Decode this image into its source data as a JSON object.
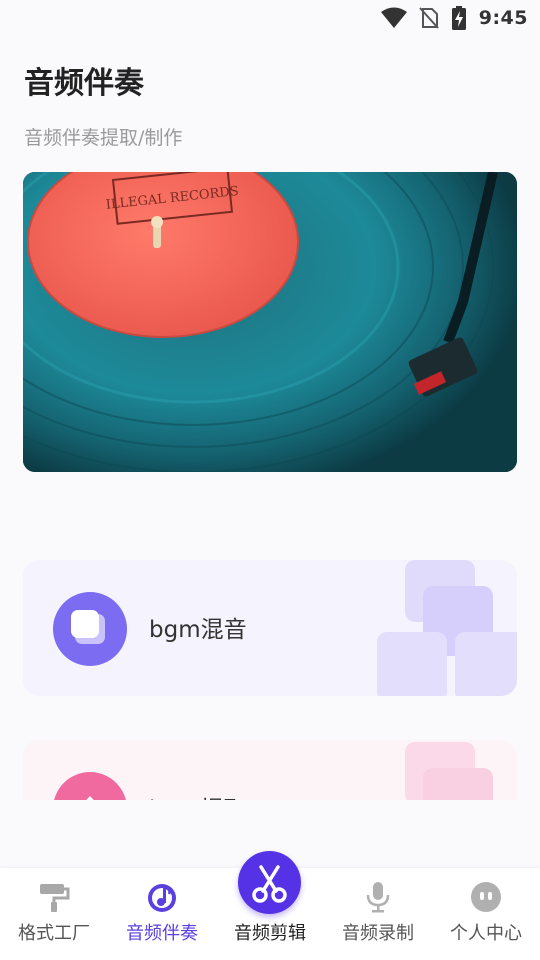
{
  "status_bar": {
    "time": "9:45",
    "icons": [
      "wifi-icon",
      "no-sim-icon",
      "battery-charging-icon"
    ]
  },
  "header": {
    "title": "音频伴奏",
    "subtitle": "音频伴奏提取/制作"
  },
  "banner": {
    "record_label_text": "ILLEGAL RECORDS"
  },
  "features": [
    {
      "label": "bgm混音",
      "icon": "bgm-mix-icon",
      "accent": "#7c6cf2"
    },
    {
      "label": "bgm提取",
      "icon": "upload-arrow-icon",
      "accent": "#f06aa0"
    }
  ],
  "bottom_nav": {
    "items": [
      {
        "label": "格式工厂",
        "icon": "paint-roller-icon",
        "active": false
      },
      {
        "label": "音频伴奏",
        "icon": "music-note-disc-icon",
        "active": true
      },
      {
        "label": "音频剪辑",
        "icon": "scissors-icon",
        "active": false
      },
      {
        "label": "音频录制",
        "icon": "microphone-icon",
        "active": false
      },
      {
        "label": "个人中心",
        "icon": "user-face-icon",
        "active": false
      }
    ]
  },
  "colors": {
    "accent": "#5b3fe0",
    "center_button": "#5632e6",
    "inactive_icon": "#9a9a9a"
  }
}
